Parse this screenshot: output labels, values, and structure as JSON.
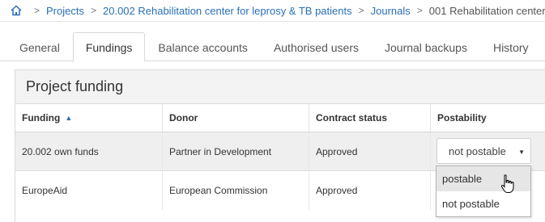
{
  "breadcrumb": {
    "home_icon": "home-icon",
    "separator": ">",
    "items": [
      "Projects",
      "20.002 Rehabilitation center for leprosy & TB patients",
      "Journals"
    ],
    "current": "001 Rehabilitation center"
  },
  "tabs": [
    {
      "label": "General"
    },
    {
      "label": "Fundings",
      "active": true
    },
    {
      "label": "Balance accounts"
    },
    {
      "label": "Authorised users"
    },
    {
      "label": "Journal backups"
    },
    {
      "label": "History"
    }
  ],
  "panel": {
    "title": "Project funding"
  },
  "table": {
    "columns": [
      "Funding",
      "Donor",
      "Contract status",
      "Postability"
    ],
    "sort_indicator": "▲",
    "rows": [
      {
        "funding": "20.002 own funds",
        "donor": "Partner in Development",
        "status": "Approved",
        "postability": "not postable"
      },
      {
        "funding": "EuropeAid",
        "donor": "European Commission",
        "status": "Approved",
        "postability": ""
      }
    ]
  },
  "select": {
    "value": "not postable",
    "caret": "▼"
  },
  "dropdown": {
    "options": [
      "postable",
      "not postable"
    ],
    "highlighted_index": 0
  },
  "colors": {
    "link": "#2a6fb8",
    "header_bg": "#f3f3f3",
    "row_highlight": "#efefef"
  }
}
